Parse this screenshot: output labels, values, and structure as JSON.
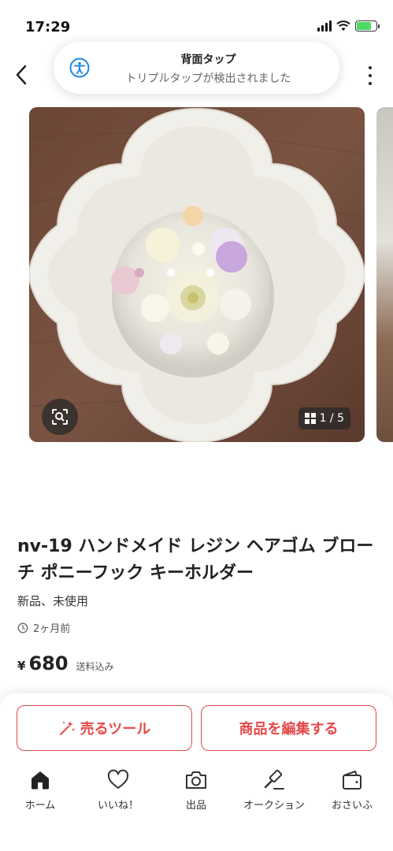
{
  "status_bar": {
    "time": "17:29"
  },
  "toast": {
    "title": "背面タップ",
    "message": "トリプルタップが検出されました"
  },
  "gallery": {
    "counter": "1 / 5"
  },
  "product": {
    "title": "nv-19 ハンドメイド レジン ヘアゴム ブローチ ポニーフック キーホルダー",
    "condition": "新品、未使用",
    "posted": "2ヶ月前",
    "currency": "¥",
    "price": "680",
    "shipping": "送料込み"
  },
  "actions": {
    "sell_tool": "売るツール",
    "edit_item": "商品を編集する"
  },
  "tabs": [
    {
      "label": "ホーム",
      "icon": "home-icon"
    },
    {
      "label": "いいね！",
      "icon": "heart-icon"
    },
    {
      "label": "出品",
      "icon": "camera-icon"
    },
    {
      "label": "オークション",
      "icon": "gavel-icon"
    },
    {
      "label": "おさいふ",
      "icon": "wallet-icon"
    }
  ],
  "colors": {
    "accent": "#e64a4a",
    "battery": "#4cd964"
  }
}
